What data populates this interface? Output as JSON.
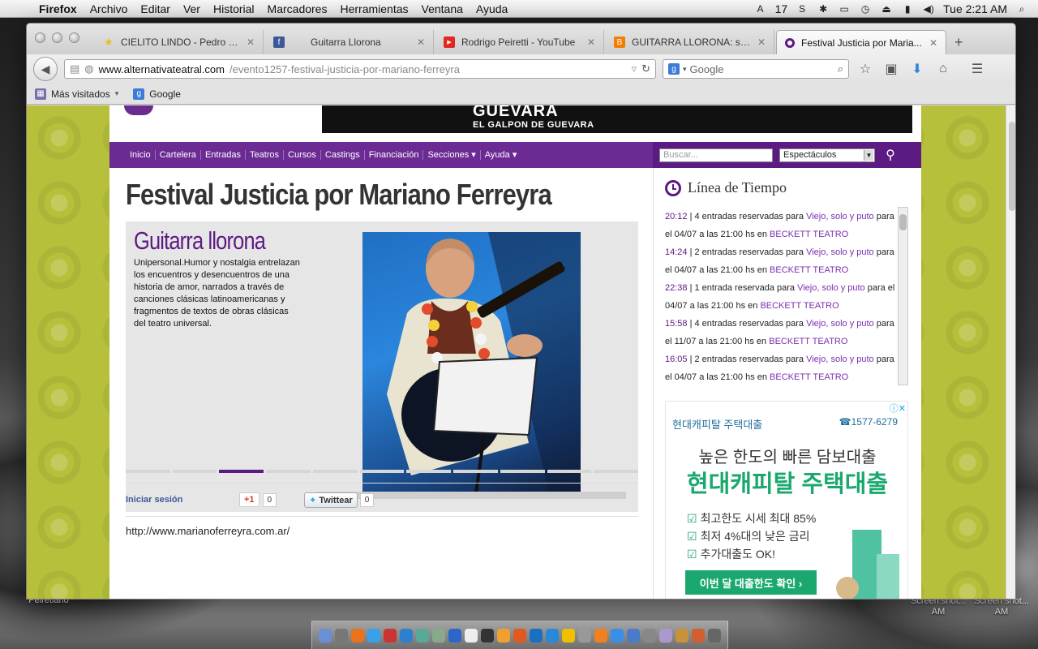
{
  "menubar": {
    "app": "Firefox",
    "items": [
      "Archivo",
      "Editar",
      "Ver",
      "Historial",
      "Marcadores",
      "Herramientas",
      "Ventana",
      "Ayuda"
    ],
    "status_number": "17",
    "clock": "Tue 2:21 AM"
  },
  "tabs": [
    {
      "title": "CIELITO LINDO - Pedro Inf...",
      "icon": "star-icon",
      "color": "#e8c01b"
    },
    {
      "title": "Guitarra Llorona",
      "icon": "facebook-icon",
      "color": "#3b5998"
    },
    {
      "title": "Rodrigo Peiretti - YouTube",
      "icon": "youtube-icon",
      "color": "#e02a20"
    },
    {
      "title": "GUITARRA LLORONA: se vi...",
      "icon": "blogger-icon",
      "color": "#f57d00"
    },
    {
      "title": "Festival Justicia por Maria...",
      "icon": "alternativa-icon",
      "color": "#5c1a83"
    }
  ],
  "urlbar": {
    "domain": "www.alternativateatral.com",
    "path": "/evento1257-festival-justicia-por-mariano-ferreyra"
  },
  "searchbar": {
    "placeholder": "Google"
  },
  "bookmarks": [
    {
      "label": "Más visitados",
      "icon": "bookmarks-folder-icon"
    },
    {
      "label": "Google",
      "icon": "google-icon"
    }
  ],
  "site": {
    "ad_top_big": "GUEVARA",
    "ad_top_small": "EL GALPON DE GUEVARA",
    "nav": [
      "Inicio",
      "Cartelera",
      "Entradas",
      "Teatros",
      "Cursos",
      "Castings",
      "Financiación",
      "Secciones ▾",
      "Ayuda ▾"
    ],
    "search_placeholder": "Buscar...",
    "search_select": "Espectáculos",
    "event_title": "Festival Justicia por Mariano Ferreyra",
    "slide_title": "Guitarra llorona",
    "slide_desc": "Unipersonal.Humor y nostalgia entrelazan los encuentros y desencuentros de una historia de amor, narrados a través de canciones clásicas latinoamericanas y fragmentos de textos de obras clásicas del teatro universal.",
    "slide_dots": 11,
    "slide_active": 3,
    "login_text": "Iniciar sesión",
    "gplus_label": "+1",
    "gplus_count": "0",
    "twitter_label": "Twittear",
    "twitter_count": "0",
    "site_url": "http://www.marianoferreyra.com.ar/",
    "timeline_title": "Línea de Tiempo",
    "timeline": [
      {
        "time": "20:12",
        "text": " | 4 entradas reservadas para ",
        "show": "Viejo, solo y puto",
        "tail": " para el 04/07 a las 21:00 hs en ",
        "venue": "BECKETT TEATRO"
      },
      {
        "time": "14:24",
        "text": " | 2 entradas reservadas para ",
        "show": "Viejo, solo y puto",
        "tail": " para el 04/07 a las 21:00 hs en ",
        "venue": "BECKETT TEATRO"
      },
      {
        "time": "22:38",
        "text": " | 1 entrada reservada para ",
        "show": "Viejo, solo y puto",
        "tail": " para el 04/07 a las 21:00 hs en ",
        "venue": "BECKETT TEATRO"
      },
      {
        "time": "15:58",
        "text": " | 4 entradas reservadas para ",
        "show": "Viejo, solo y puto",
        "tail": " para el 11/07 a las 21:00 hs en ",
        "venue": "BECKETT TEATRO"
      },
      {
        "time": "16:05",
        "text": " | 2 entradas reservadas para ",
        "show": "Viejo, solo y puto",
        "tail": " para el 04/07 a las 21:00 hs en ",
        "venue": "BECKETT TEATRO"
      }
    ],
    "ad_side": {
      "brand": "현대캐피탈 주택대출",
      "phone": "☎1577-6279",
      "line1": "높은 한도의 빠른 담보대출",
      "line2": "현대캐피탈 주택대출",
      "checks": [
        "최고한도 시세 최대 85%",
        "최저 4%대의 낮은 금리",
        "추가대출도 OK!"
      ],
      "cta": "이번 달 대출한도 확인 ›"
    }
  },
  "desktop": {
    "labels": [
      "Peiretiano",
      "Screen shot... AM",
      "Screen shot... AM"
    ]
  }
}
